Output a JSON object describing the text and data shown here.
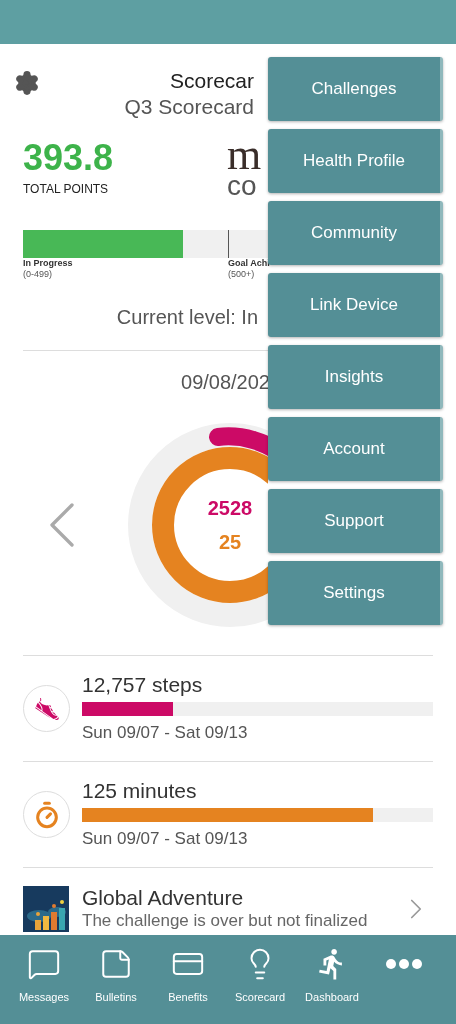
{
  "scorecard": {
    "title": "Scorecar",
    "subtitle": "Q3 Scorecard",
    "points": "393.8",
    "points_label": "TOTAL POINTS",
    "logo_mark": "m",
    "logo_word": "co"
  },
  "progress": {
    "segments": [
      {
        "label": "In Progress",
        "range": "(0-499)"
      },
      {
        "label": "Goal Achi",
        "range": "(500+)"
      }
    ]
  },
  "current_level": "Current level: In",
  "date": "09/08/202",
  "ring": {
    "steps": "2528",
    "minutes": "25"
  },
  "stats": [
    {
      "kind": "steps",
      "title": "12,757 steps",
      "level": 0.26,
      "dates": "Sun 09/07 - Sat 09/13",
      "color": "#cc0a66"
    },
    {
      "kind": "minutes",
      "title": "125 minutes",
      "level": 0.83,
      "dates": "Sun 09/07 - Sat 09/13",
      "color": "#e58320"
    }
  ],
  "challenge": {
    "title": "Global Adventure",
    "description": "The challenge is over but not finalized"
  },
  "menu": [
    "Challenges",
    "Health Profile",
    "Community",
    "Link Device",
    "Insights",
    "Account",
    "Support",
    "Settings"
  ],
  "nav": [
    {
      "kind": "messages",
      "label": "Messages"
    },
    {
      "kind": "bulletins",
      "label": "Bulletins"
    },
    {
      "kind": "benefits",
      "label": "Benefits"
    },
    {
      "kind": "scorecard",
      "label": "Scorecard"
    },
    {
      "kind": "dashboard",
      "label": "Dashboard"
    },
    {
      "kind": "more"
    }
  ]
}
